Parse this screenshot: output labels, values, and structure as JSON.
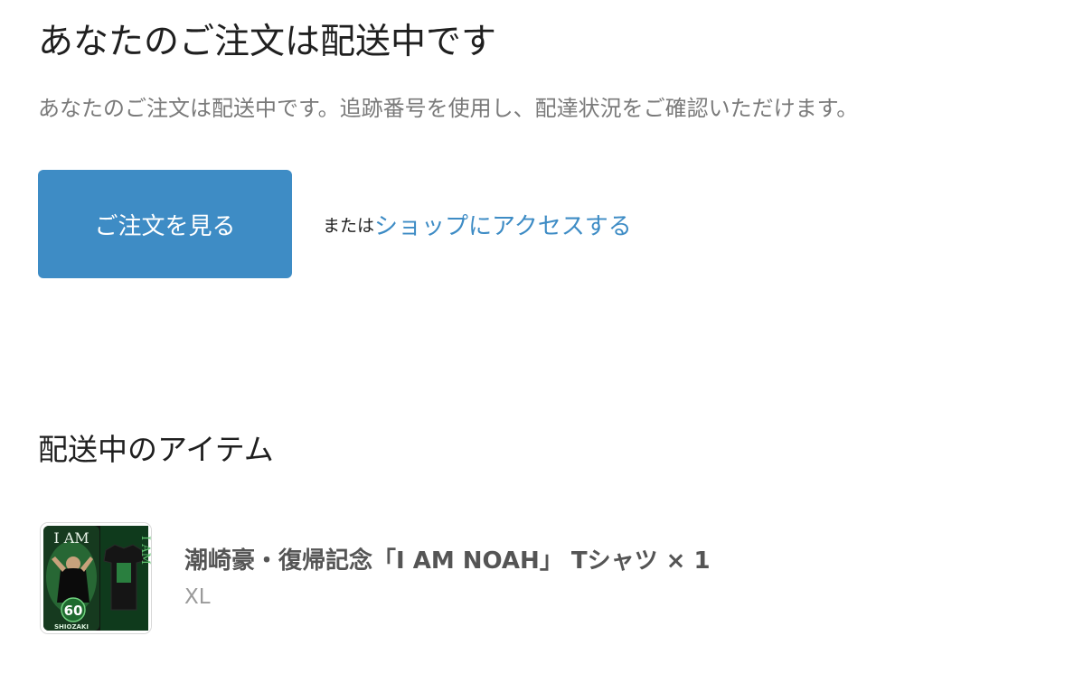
{
  "heading": {
    "title": "あなたのご注文は配送中です",
    "description": "あなたのご注文は配送中です。追跡番号を使用し、配達状況をご確認いただけます。"
  },
  "actions": {
    "view_order_label": "ご注文を見る",
    "or_text": "または",
    "visit_shop_label": "ショップにアクセスする"
  },
  "shipped_items": {
    "section_title": "配送中のアイテム",
    "items": [
      {
        "name": "潮崎豪・復帰記念「I AM NOAH」 Tシャツ",
        "quantity": "× 1",
        "variant": "XL",
        "thumbnail_text": {
          "top": "I AM",
          "side": "I AM",
          "number": "60",
          "brand": "SHIOZAKI"
        }
      }
    ]
  },
  "colors": {
    "accent": "#3e8cc5",
    "text_primary": "#1f1f1f",
    "text_muted": "#7a7a7a",
    "thumbnail_green": "#2f9a4a"
  }
}
